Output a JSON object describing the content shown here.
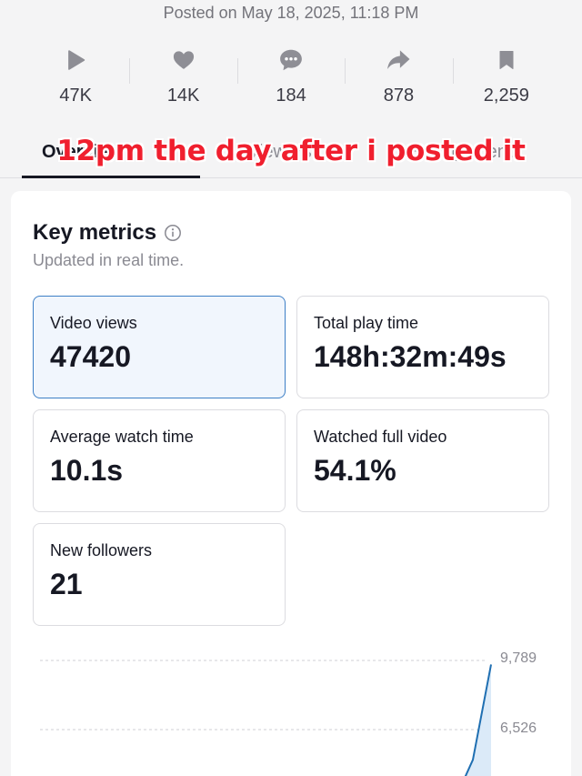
{
  "header": {
    "posted_on": "Posted on May 18, 2025, 11:18 PM"
  },
  "stats": [
    {
      "icon": "play-icon",
      "value": "47K"
    },
    {
      "icon": "heart-icon",
      "value": "14K"
    },
    {
      "icon": "comment-icon",
      "value": "184"
    },
    {
      "icon": "share-icon",
      "value": "878"
    },
    {
      "icon": "bookmark-icon",
      "value": "2,259"
    }
  ],
  "tabs": {
    "overview": "Overview",
    "viewers": "Viewers",
    "engagement": "Engagement"
  },
  "overlay_caption": "12pm the day after i posted it",
  "key_metrics": {
    "title": "Key metrics",
    "subtitle": "Updated in real time.",
    "metrics": [
      {
        "label": "Video views",
        "value": "47420",
        "selected": true
      },
      {
        "label": "Total play time",
        "value": "148h:32m:49s"
      },
      {
        "label": "Average watch time",
        "value": "10.1s"
      },
      {
        "label": "Watched full video",
        "value": "54.1%"
      },
      {
        "label": "New followers",
        "value": "21"
      }
    ]
  },
  "chart_data": {
    "type": "area",
    "y_ticks": [
      "9,789",
      "6,526"
    ],
    "y_tick_values": [
      9789,
      6526
    ],
    "values_visible_tail": [
      3200,
      5100,
      9600
    ],
    "color": "#1f6fb2",
    "fill": "#dbeaf8",
    "grid": true
  }
}
